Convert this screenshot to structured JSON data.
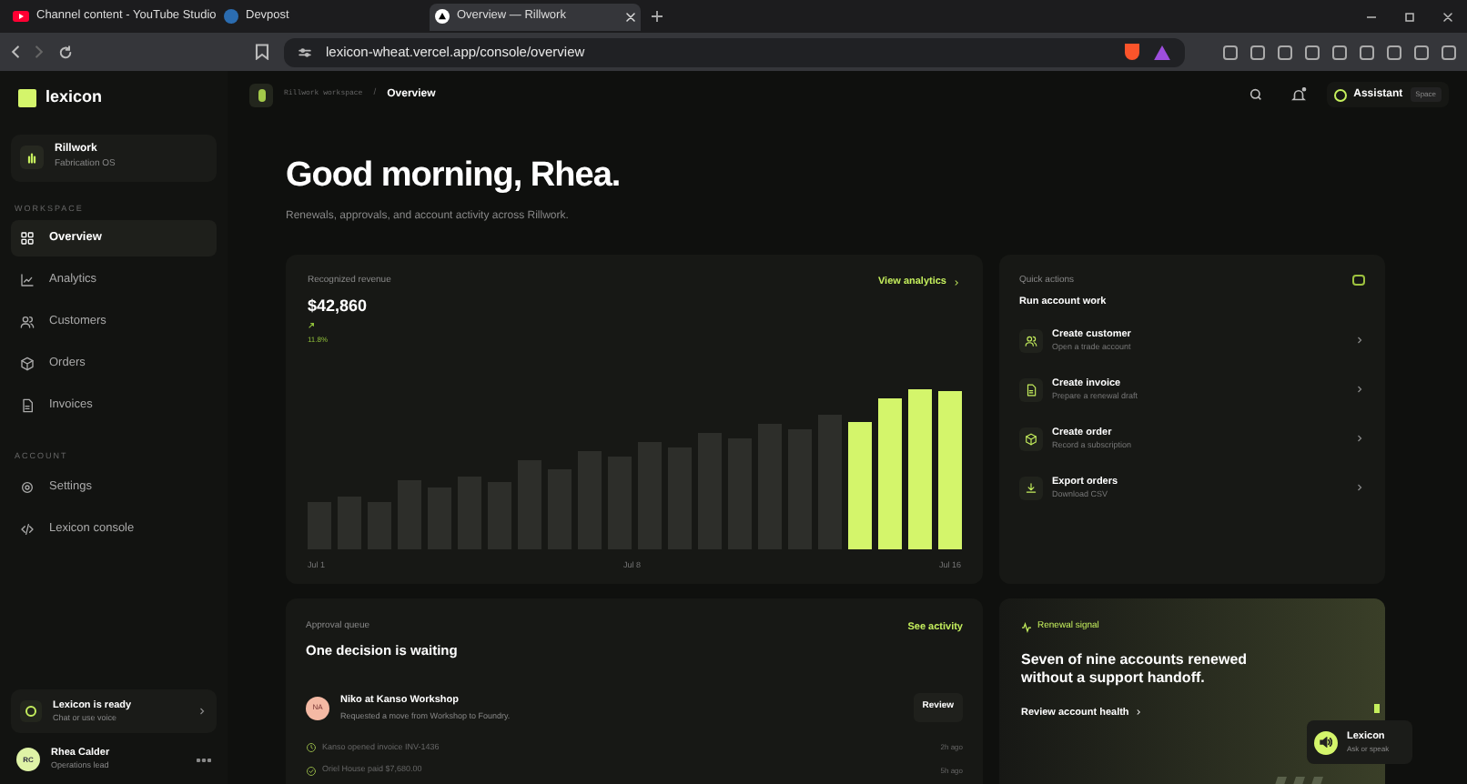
{
  "browser": {
    "tabs": [
      {
        "title": "Channel content - YouTube Studio",
        "selected": false
      },
      {
        "title": "Devpost",
        "selected": false
      },
      {
        "title": "Overview — Rillwork",
        "selected": true
      }
    ],
    "url": "lexicon-wheat.vercel.app/console/overview"
  },
  "sidebar": {
    "brand": "lexicon",
    "workspace": {
      "name": "Rillwork",
      "subtitle": "Fabrication OS"
    },
    "sections": [
      {
        "heading": "WORKSPACE",
        "items": [
          {
            "label": "Overview",
            "selected": true
          },
          {
            "label": "Analytics",
            "selected": false
          },
          {
            "label": "Customers",
            "selected": false
          },
          {
            "label": "Orders",
            "selected": false
          },
          {
            "label": "Invoices",
            "selected": false
          }
        ]
      },
      {
        "heading": "ACCOUNT",
        "items": [
          {
            "label": "Settings",
            "selected": false
          },
          {
            "label": "Lexicon console",
            "selected": false
          }
        ]
      }
    ],
    "assistant_card": {
      "title": "Lexicon is ready",
      "subtitle": "Chat or use voice"
    },
    "user": {
      "initials": "RC",
      "name": "Rhea Calder",
      "role": "Operations lead"
    }
  },
  "header": {
    "breadcrumb": "Rillwork workspace",
    "separator": "/",
    "current": "Overview",
    "assistant": "Assistant",
    "shortcut": "Space"
  },
  "greeting": "Good morning, Rhea.",
  "subtitle": "Renewals, approvals, and account activity across Rillwork.",
  "revenue": {
    "label": "Recognized revenue",
    "amount": "$42,860",
    "change": "11.8%",
    "link": "View analytics",
    "x_labels": [
      "Jul 1",
      "Jul 8",
      "Jul 16"
    ]
  },
  "quick_actions": {
    "label": "Quick actions",
    "title": "Run account work",
    "items": [
      {
        "title": "Create customer",
        "subtitle": "Open a trade account"
      },
      {
        "title": "Create invoice",
        "subtitle": "Prepare a renewal draft"
      },
      {
        "title": "Create order",
        "subtitle": "Record a subscription"
      },
      {
        "title": "Export orders",
        "subtitle": "Download CSV"
      }
    ]
  },
  "approval": {
    "label": "Approval queue",
    "title": "One decision is waiting",
    "link": "See activity",
    "request": {
      "initials": "NA",
      "name": "Niko at Kanso Workshop",
      "detail": "Requested a move from Workshop to Foundry.",
      "button": "Review"
    },
    "activity": [
      {
        "text": "Kanso opened invoice INV-1436",
        "time": "2h ago"
      },
      {
        "text": "Oriel House paid $7,680.00",
        "time": "5h ago"
      }
    ]
  },
  "renewal": {
    "label": "Renewal signal",
    "headline": "Seven of nine accounts renewed without a support handoff.",
    "link": "Review account health"
  },
  "voice": {
    "title": "Lexicon",
    "subtitle": "Ask or speak"
  }
}
